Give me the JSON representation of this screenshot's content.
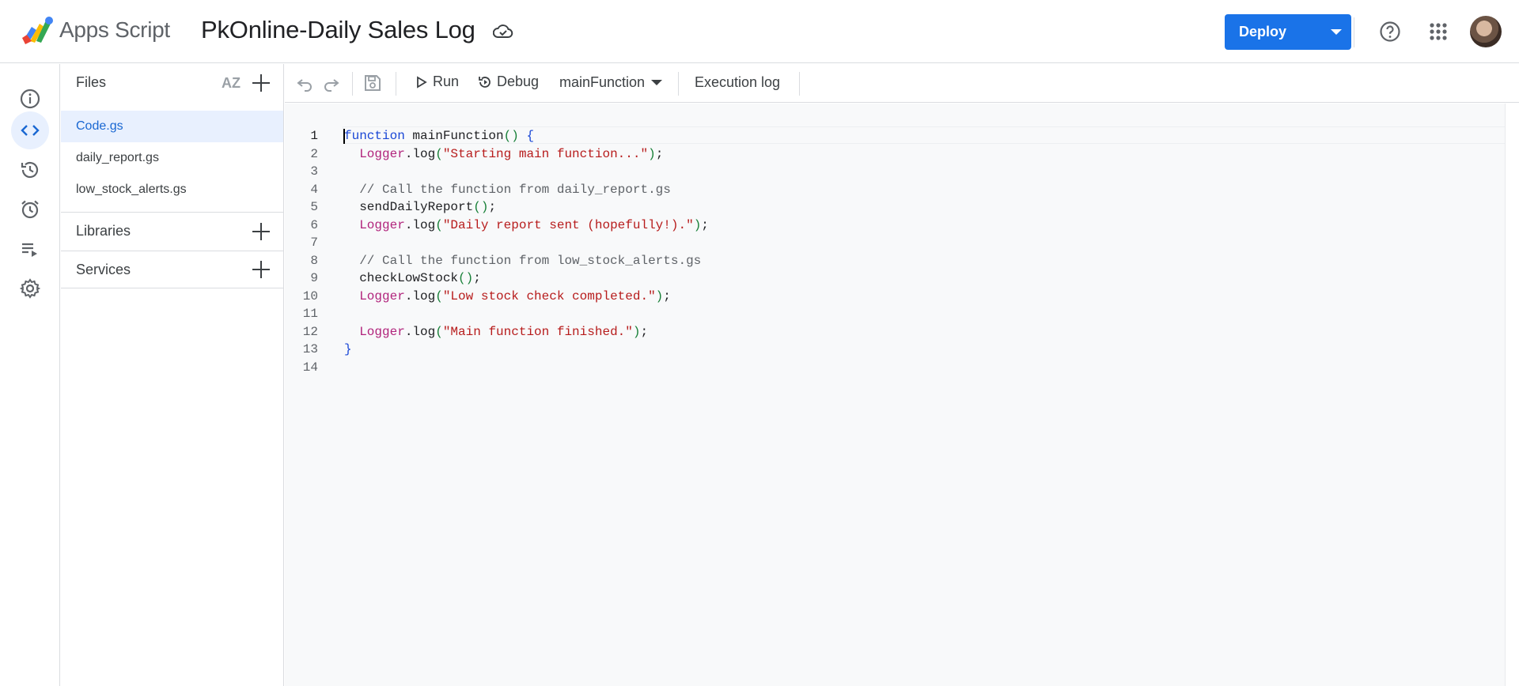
{
  "header": {
    "app_name": "Apps Script",
    "project_title": "PkOnline-Daily Sales Log",
    "deploy_label": "Deploy",
    "icons": [
      "apps-script-logo",
      "cloud-saved-icon",
      "help-icon",
      "apps-grid-icon",
      "avatar"
    ]
  },
  "rail": {
    "items": [
      "overview-icon",
      "editor-icon",
      "history-icon",
      "triggers-icon",
      "executions-icon",
      "settings-icon"
    ],
    "active": "editor-icon"
  },
  "files_panel": {
    "files_label": "Files",
    "sort_label": "AZ",
    "files": [
      "Code.gs",
      "daily_report.gs",
      "low_stock_alerts.gs"
    ],
    "active_file": "Code.gs",
    "libraries_label": "Libraries",
    "services_label": "Services"
  },
  "toolbar": {
    "run_label": "Run",
    "debug_label": "Debug",
    "function_select": "mainFunction",
    "execution_log_label": "Execution log"
  },
  "editor": {
    "line_numbers": [
      "1",
      "2",
      "3",
      "4",
      "5",
      "6",
      "7",
      "8",
      "9",
      "10",
      "11",
      "12",
      "13",
      "14"
    ],
    "lines": [
      "function mainFunction() {",
      "  Logger.log(\"Starting main function...\");",
      "",
      "  // Call the function from daily_report.gs",
      "  sendDailyReport();",
      "  Logger.log(\"Daily report sent (hopefully!).\");",
      "",
      "  // Call the function from low_stock_alerts.gs",
      "  checkLowStock();",
      "  Logger.log(\"Low stock check completed.\");",
      "",
      "  Logger.log(\"Main function finished.\");",
      "}",
      ""
    ]
  },
  "colors": {
    "accent": "#1a73e8",
    "active_bg": "#e8f0fe",
    "keyword": "#1a47d6",
    "object": "#b1247c",
    "string": "#b71c1c",
    "comment": "#5f6368"
  }
}
